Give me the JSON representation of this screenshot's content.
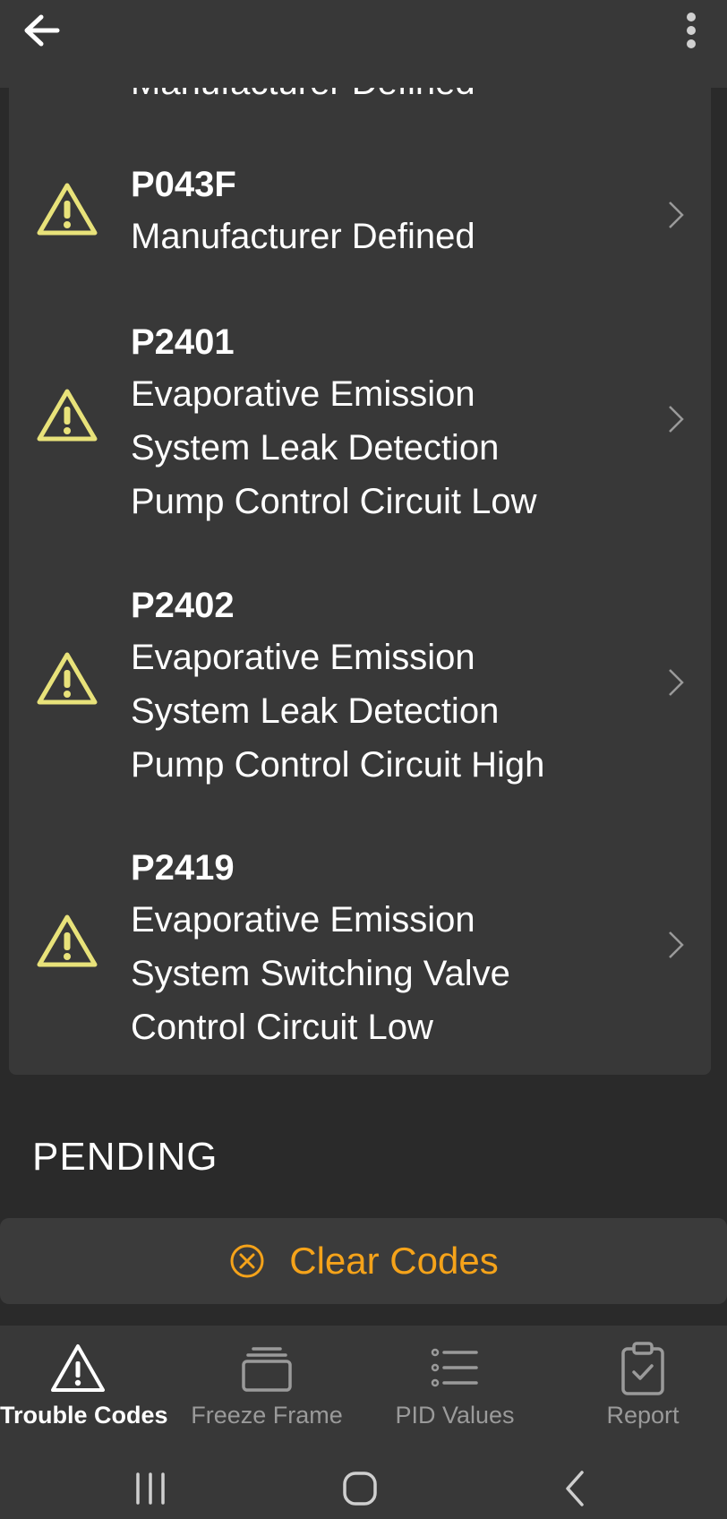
{
  "list": {
    "peek_label": "Manufacturer Defined",
    "items": [
      {
        "code": "P043F",
        "lines": [
          "Manufacturer Defined"
        ]
      },
      {
        "code": "P2401",
        "lines": [
          "Evaporative Emission",
          "System Leak Detection",
          "Pump Control Circuit Low"
        ]
      },
      {
        "code": "P2402",
        "lines": [
          "Evaporative Emission",
          "System Leak Detection",
          "Pump Control Circuit High"
        ]
      },
      {
        "code": "P2419",
        "lines": [
          "Evaporative Emission",
          "System Switching Valve",
          "Control Circuit Low"
        ]
      }
    ]
  },
  "section": {
    "pending_title": "PENDING"
  },
  "actions": {
    "clear_label": "Clear Codes"
  },
  "nav": {
    "items": [
      {
        "label": "Trouble Codes",
        "icon": "warning-triangle-icon",
        "active": true
      },
      {
        "label": "Freeze Frame",
        "icon": "stack-icon",
        "active": false
      },
      {
        "label": "PID Values",
        "icon": "list-icon",
        "active": false
      },
      {
        "label": "Report",
        "icon": "clipboard-check-icon",
        "active": false
      }
    ]
  },
  "colors": {
    "accent": "#f5a31a",
    "warning": "#e8e27a",
    "surface": "#383838",
    "background": "#2a2a2a"
  }
}
